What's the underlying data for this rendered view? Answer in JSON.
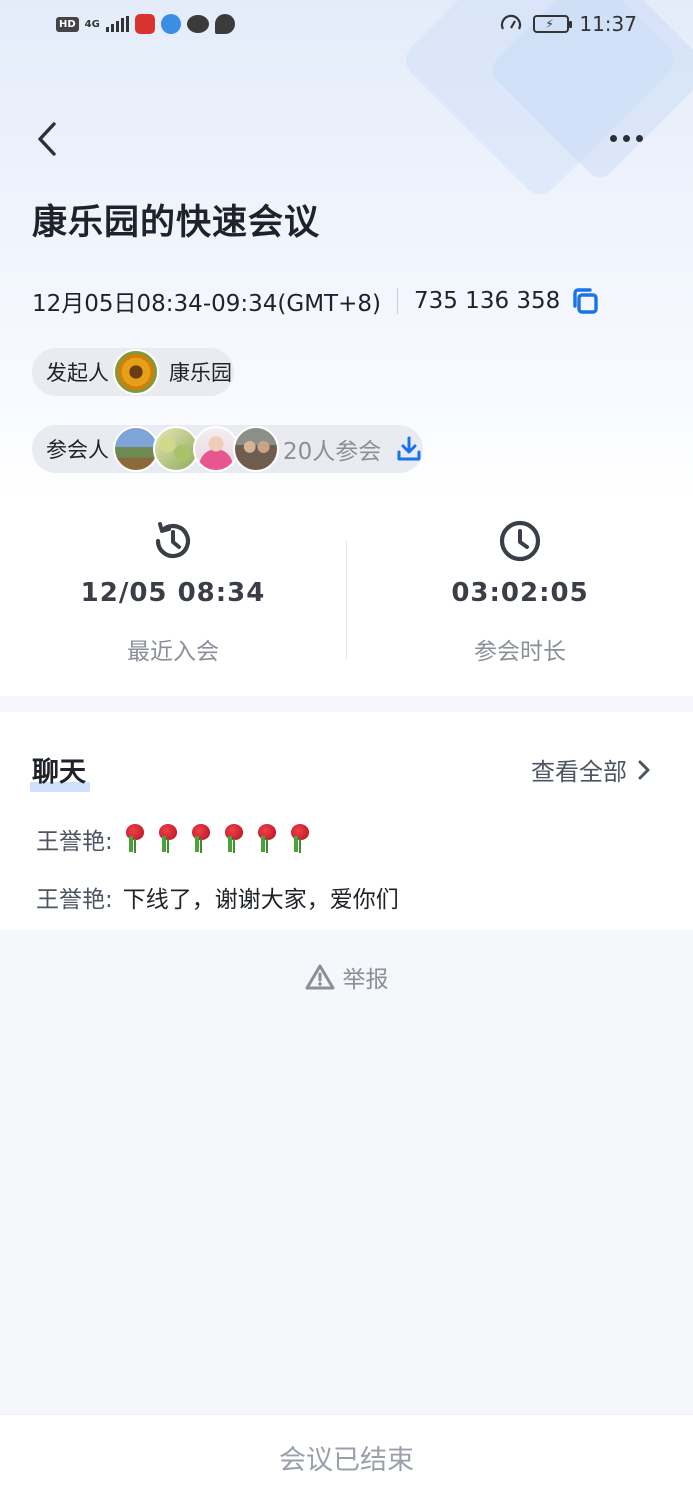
{
  "status_bar": {
    "hd": "HD",
    "signal": "4G",
    "time": "11:37"
  },
  "meeting": {
    "title": "康乐园的快速会议",
    "time_range": "12月05日08:34-09:34(GMT+8)",
    "meeting_id": "735 136 358",
    "organizer_label": "发起人",
    "organizer_name": "康乐园",
    "participants_label": "参会人",
    "participants_count": "20人参会"
  },
  "stats": {
    "last_join_value": "12/05 08:34",
    "last_join_label": "最近入会",
    "duration_value": "03:02:05",
    "duration_label": "参会时长"
  },
  "chat": {
    "title": "聊天",
    "view_all": "查看全部",
    "messages": [
      {
        "sender": "王誉艳:",
        "text": "",
        "roses": 6
      },
      {
        "sender": "王誉艳:",
        "text": "下线了，谢谢大家，爱你们"
      }
    ]
  },
  "report_label": "举报",
  "footer_status": "会议已结束",
  "colors": {
    "accent": "#1a73e8",
    "title": "#1f2329",
    "muted": "#8a8f99"
  },
  "icons": [
    "back-icon",
    "more-icon",
    "copy-icon",
    "download-icon",
    "history-icon",
    "clock-icon",
    "chevron-right-icon",
    "warning-icon",
    "rose-emoji"
  ]
}
